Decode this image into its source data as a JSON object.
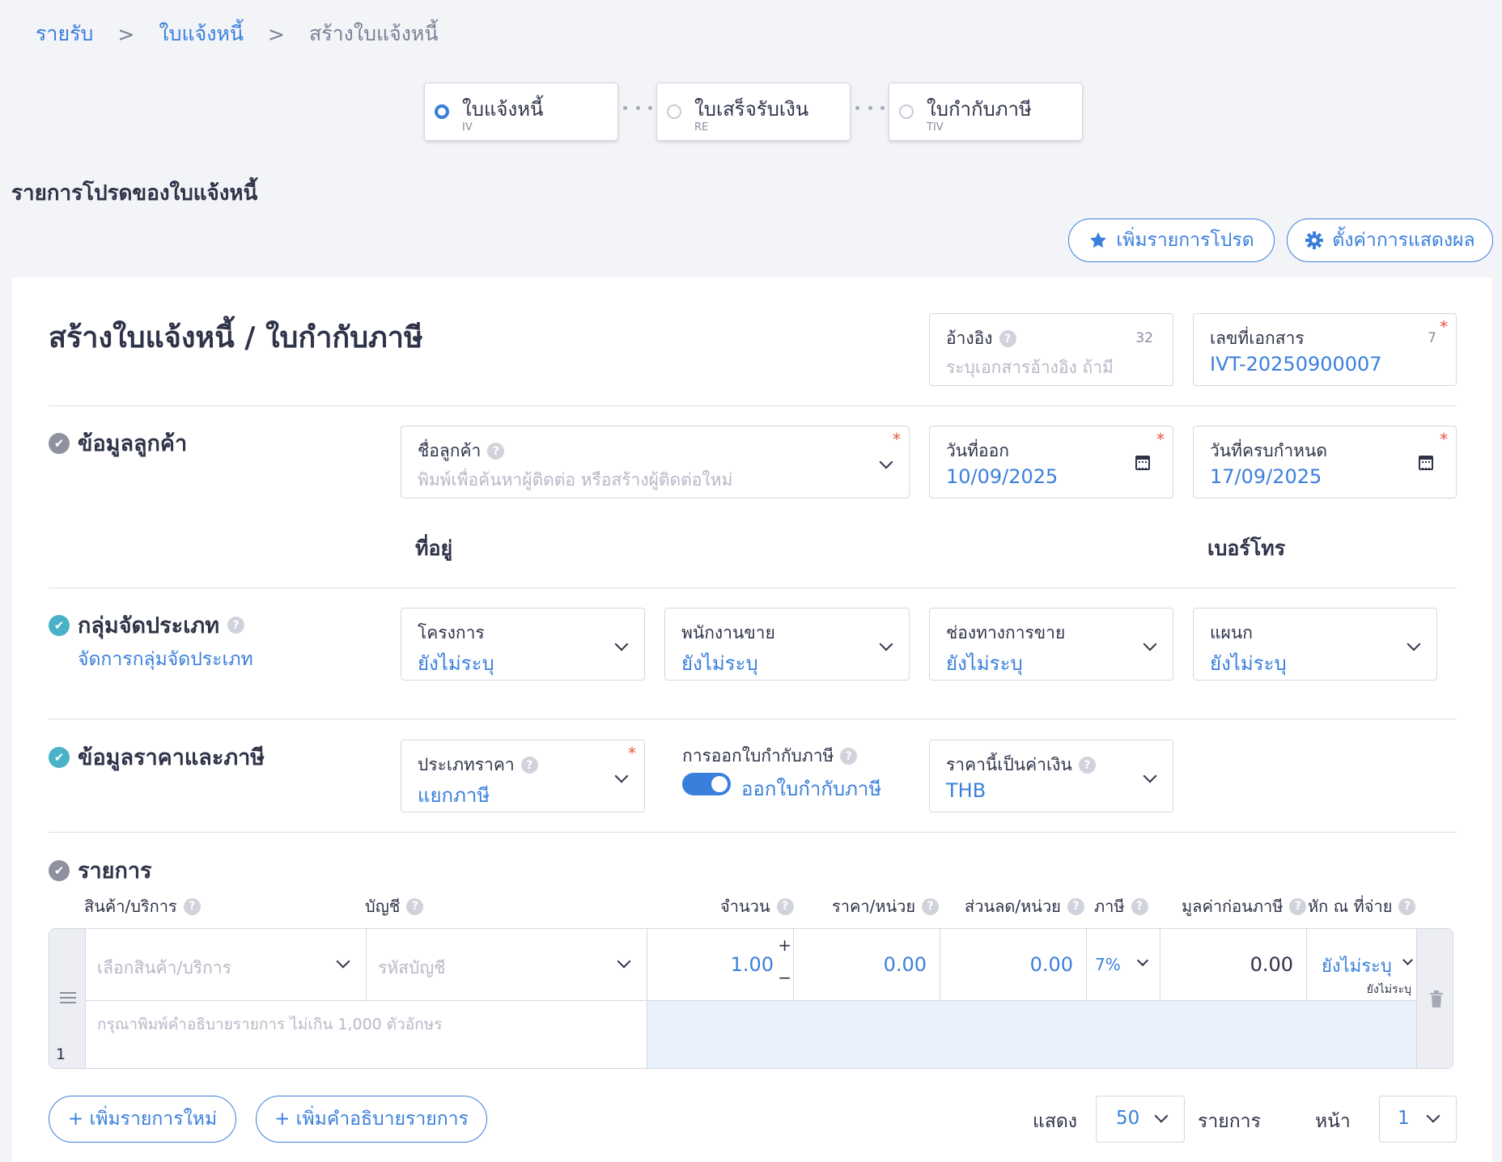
{
  "breadcrumb": {
    "item1": "รายรับ",
    "item2": "ใบแจ้งหนี้",
    "item3": "สร้างใบแจ้งหนี้",
    "sep": ">"
  },
  "steps": [
    {
      "title": "ใบแจ้งหนี้",
      "code": "IV"
    },
    {
      "title": "ใบเสร็จรับเงิน",
      "code": "RE"
    },
    {
      "title": "ใบกำกับภาษี",
      "code": "TIV"
    }
  ],
  "favorites_title": "รายการโปรดของใบแจ้งหนี้",
  "actions": {
    "add_favorite": "เพิ่มรายการโปรด",
    "display_settings": "ตั้งค่าการแสดงผล"
  },
  "form": {
    "title": "สร้างใบแจ้งหนี้ / ใบกำกับภาษี",
    "reference": {
      "label": "อ้างอิง",
      "count": "32",
      "placeholder": "ระบุเอกสารอ้างอิง ถ้ามี"
    },
    "doc_number": {
      "label": "เลขที่เอกสาร",
      "count": "7",
      "value": "IVT-20250900007"
    },
    "customer_section": "ข้อมูลลูกค้า",
    "customer": {
      "label": "ชื่อลูกค้า",
      "placeholder": "พิมพ์เพื่อค้นหาผู้ติดต่อ หรือสร้างผู้ติดต่อใหม่"
    },
    "issue_date": {
      "label": "วันที่ออก",
      "value": "10/09/2025"
    },
    "due_date": {
      "label": "วันที่ครบกำหนด",
      "value": "17/09/2025"
    },
    "address_label": "ที่อยู่",
    "phone_label": "เบอร์โทร",
    "category_section": "กลุ่มจัดประเภท",
    "manage_category": "จัดการกลุ่มจัดประเภท",
    "project": {
      "label": "โครงการ",
      "value": "ยังไม่ระบุ"
    },
    "salesperson": {
      "label": "พนักงานขาย",
      "value": "ยังไม่ระบุ"
    },
    "channel": {
      "label": "ช่องทางการขาย",
      "value": "ยังไม่ระบุ"
    },
    "department": {
      "label": "แผนก",
      "value": "ยังไม่ระบุ"
    },
    "pricing_section": "ข้อมูลราคาและภาษี",
    "price_type": {
      "label": "ประเภทราคา",
      "value": "แยกภาษี"
    },
    "tax_invoice": {
      "label": "การออกใบกำกับภาษี",
      "value": "ออกใบกำกับภาษี"
    },
    "currency": {
      "label": "ราคานี้เป็นค่าเงิน",
      "value": "THB"
    },
    "items_section": "รายการ"
  },
  "items_table": {
    "columns": {
      "product": "สินค้า/บริการ",
      "account": "บัญชี",
      "qty": "จำนวน",
      "price": "ราคา/หน่วย",
      "discount": "ส่วนลด/หน่วย",
      "tax": "ภาษี",
      "pretax": "มูลค่าก่อนภาษี",
      "withholding": "หัก ณ ที่จ่าย"
    },
    "row": {
      "index": "1",
      "product_placeholder": "เลือกสินค้า/บริการ",
      "account_placeholder": "รหัสบัญชี",
      "qty": "1.00",
      "price": "0.00",
      "discount": "0.00",
      "tax": "7%",
      "pretax": "0.00",
      "withholding": "ยังไม่ระบุ",
      "withholding_sub": "ยังไม่ระบุ",
      "desc_placeholder": "กรุณาพิมพ์คำอธิบายรายการ ไม่เกิน 1,000 ตัวอักษร"
    }
  },
  "footer": {
    "add_item": "+ เพิ่มรายการใหม่",
    "add_desc": "+ เพิ่มคำอธิบายรายการ",
    "show_label": "แสดง",
    "page_size": "50",
    "items_label": "รายการ",
    "page_label": "หน้า",
    "page": "1"
  }
}
